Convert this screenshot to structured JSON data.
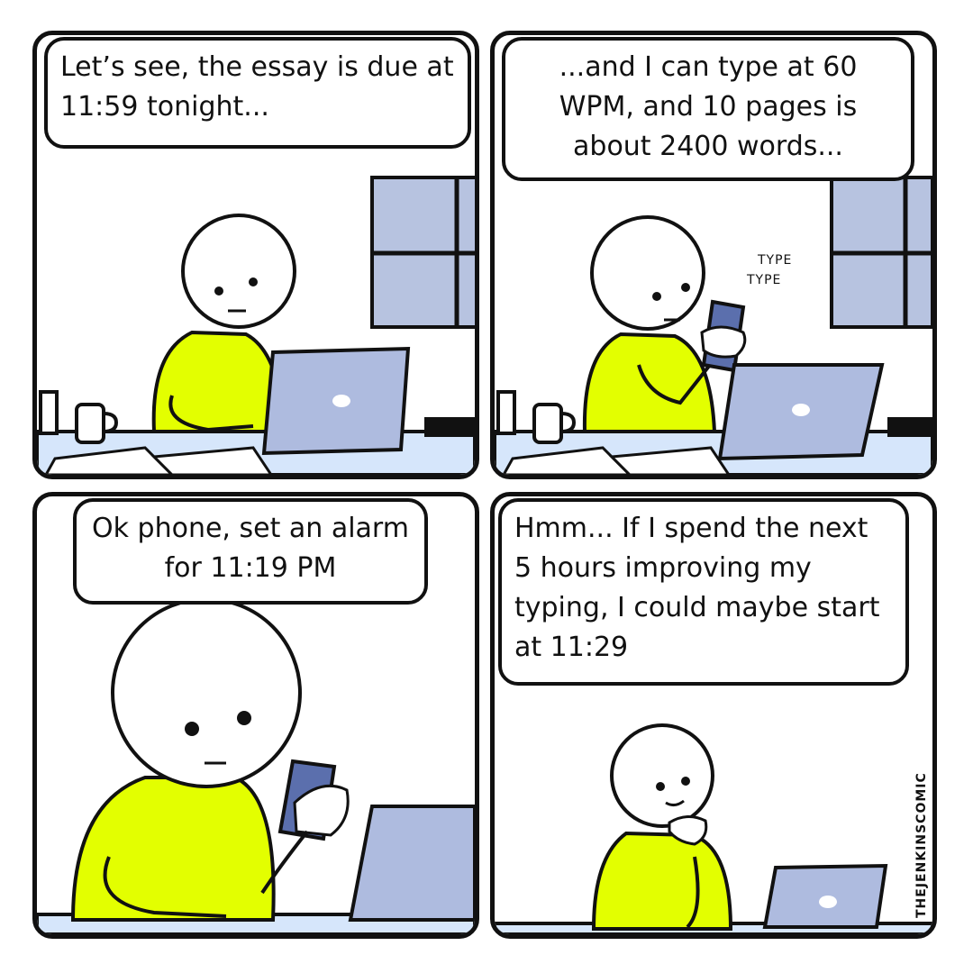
{
  "colors": {
    "shirt": "#e3ff00",
    "laptop": "#aebbdf",
    "window": "#b7c3e0",
    "floor": "#d6e6fb",
    "phone": "#5b6fad",
    "ink": "#111111"
  },
  "panels": [
    {
      "speech": "Let’s see, the essay is due at 11:59 tonight..."
    },
    {
      "speech": "...and I can type at 60 WPM, and 10 pages is about 2400 words...",
      "sfx": [
        "TYPE",
        "TYPE"
      ]
    },
    {
      "speech": "Ok phone, set an alarm for 11:19 PM"
    },
    {
      "speech": "Hmm... If I spend the next 5 hours improving my typing, I could maybe start at 11:29",
      "credit": "THEJENKINSCOMIC"
    }
  ]
}
